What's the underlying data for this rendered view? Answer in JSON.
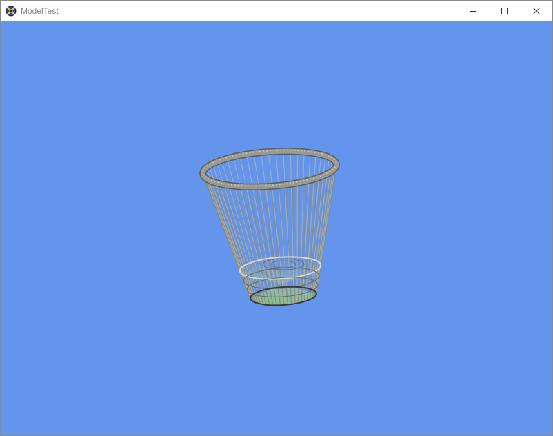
{
  "window": {
    "title": "ModelTest",
    "background_color": "#6495ed",
    "icon": "xna-logo-icon"
  },
  "caption_buttons": [
    {
      "name": "minimize",
      "icon": "minimize-icon"
    },
    {
      "name": "maximize",
      "icon": "maximize-icon"
    },
    {
      "name": "close",
      "icon": "close-icon"
    }
  ],
  "scene": {
    "model": "wire-waste-basket",
    "model_colors": {
      "wire": "#8c8c80",
      "rim": "#9a9a92",
      "base_tint": "#8fc77a"
    }
  }
}
